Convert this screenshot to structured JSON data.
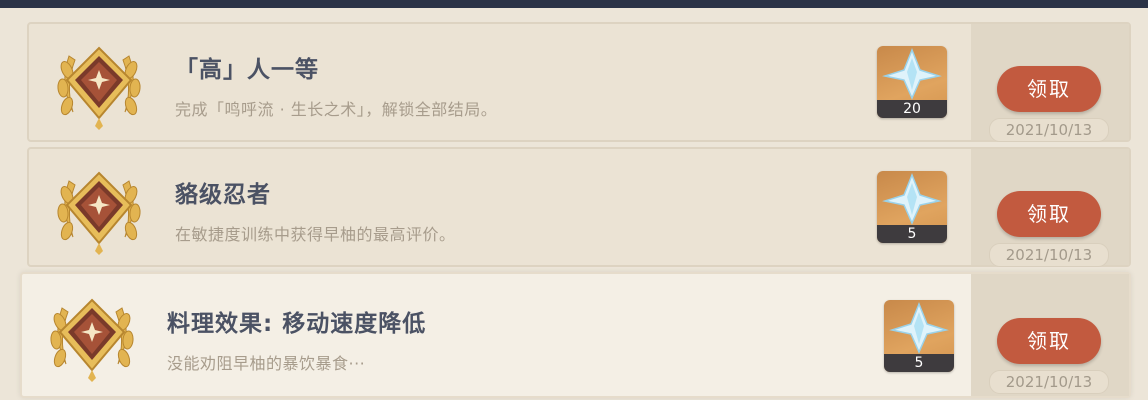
{
  "achievements": [
    {
      "title": "「高」人一等",
      "description": "完成「鸣呼流 · 生长之术」，解锁全部结局。",
      "reward": {
        "icon": "primogem-icon",
        "count": "20"
      },
      "claim_label": "领取",
      "date": "2021/10/13"
    },
    {
      "title": "貉级忍者",
      "description": "在敏捷度训练中获得早柚的最高评价。",
      "reward": {
        "icon": "primogem-icon",
        "count": "5"
      },
      "claim_label": "领取",
      "date": "2021/10/13"
    },
    {
      "title": "料理效果: 移动速度降低",
      "description": "没能劝阻早柚的暴饮暴食···",
      "reward": {
        "icon": "primogem-icon",
        "count": "5"
      },
      "claim_label": "领取",
      "date": "2021/10/13"
    }
  ],
  "colors": {
    "claim_button": "#c25a3f",
    "row_background": "#ebe3d4",
    "title_text": "#4b5264",
    "description_text": "#a79c8c"
  }
}
